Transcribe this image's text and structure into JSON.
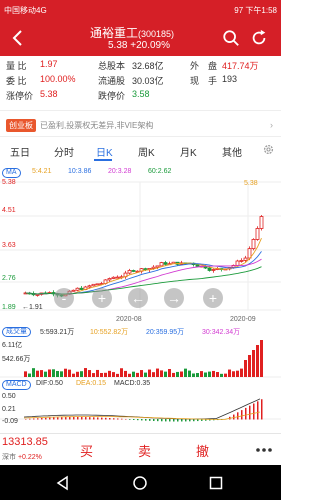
{
  "status": {
    "carrier": "中国移动4G",
    "time": "下午1:58",
    "battery": "97"
  },
  "title": {
    "name": "通裕重工",
    "code": "(300185)",
    "price": "5.38",
    "change": "+20.09%"
  },
  "quote": {
    "row1": [
      {
        "label": "量 比",
        "value": "1.97"
      },
      {
        "label": "总股本",
        "value": "32.68亿"
      },
      {
        "label": "外　盘",
        "value": "417.74万"
      }
    ],
    "row2": [
      {
        "label": "委 比",
        "value": "100.00%"
      },
      {
        "label": "流通股",
        "value": "30.03亿"
      },
      {
        "label": "现　手",
        "value": "193"
      }
    ],
    "row3": [
      {
        "label": "涨停价",
        "value": "5.38"
      },
      {
        "label": "跌停价",
        "value": "3.58"
      }
    ]
  },
  "tags": {
    "board": "创业板",
    "text": "已盈利,投票权无差异,非VIE架构"
  },
  "tabs": [
    "五日",
    "分时",
    "日K",
    "周K",
    "月K",
    "其他"
  ],
  "active_tab": "日K",
  "ma": {
    "label": "MA",
    "ma5": "5:4.21",
    "ma10": "10:3.86",
    "ma20": "20:3.28",
    "ma60": "60:2.62"
  },
  "chart_labels": {
    "y_top": "5.38",
    "y_2": "4.51",
    "y_3": "3.63",
    "y_4": "2.76",
    "y_bottom": "1.89",
    "low_marker": "1.91",
    "high_marker": "5.38",
    "x1": "2020-08",
    "x2": "2020-09"
  },
  "controls": [
    "-",
    "+",
    "←",
    "→",
    "+"
  ],
  "vol": {
    "label": "成交量",
    "v5": "5:593.21万",
    "v10": "10:552.82万",
    "v20": "20:359.95万",
    "v30": "30:342.34万",
    "y_top": "6.11亿",
    "y_mid": "542.66万"
  },
  "macd": {
    "label": "MACD",
    "dif": "DIF:0.50",
    "dea": "DEA:0.15",
    "macd": "MACD:0.35",
    "y1": "0.50",
    "y2": "0.21",
    "y3": "-0.09"
  },
  "bottom": {
    "price": "13313.85",
    "sub_label": "深市",
    "sub_change": "+0.22%",
    "buy": "买",
    "sell": "卖",
    "cancel": "撤"
  },
  "colors": {
    "up": "#e02020",
    "down": "#1a9a3a",
    "ma5": "#e6a021",
    "ma10": "#2a6fe0",
    "ma20": "#d23bd2",
    "ma60": "#1a9a3a",
    "header": "#d51f27"
  }
}
